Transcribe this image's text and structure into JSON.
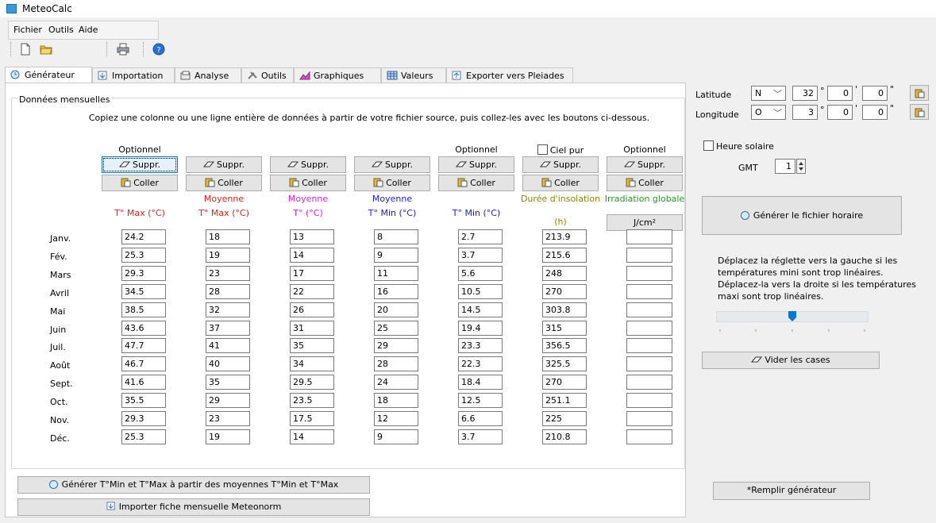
{
  "window": {
    "title": "MeteoCalc"
  },
  "menu": [
    "Fichier",
    "Outils",
    "Aide"
  ],
  "tabs": [
    "Générateur",
    "Importation",
    "Analyse",
    "Outils",
    "Graphiques",
    "Valeurs",
    "Exporter vers Pleiades"
  ],
  "group": {
    "label": "Données mensuelles"
  },
  "instructions": "Copiez une colonne ou une ligne entière de données à partir de votre fichier source, puis collez-les avec les boutons ci-dessous.",
  "buttons": {
    "suppr": "Suppr.",
    "coller": "Coller",
    "unit_jcm2": "J/cm²"
  },
  "columns": [
    {
      "top": "Optionnel",
      "sub": "",
      "label": "T° Max (°C)"
    },
    {
      "top": "",
      "sub": "Moyenne",
      "label": "T° Max (°C)"
    },
    {
      "top": "",
      "sub": "Moyenne",
      "label": "T° (°C)"
    },
    {
      "top": "",
      "sub": "Moyenne",
      "label": "T° Min (°C)"
    },
    {
      "top": "Optionnel",
      "sub": "",
      "label": "T° Min (°C)"
    },
    {
      "top": "Ciel pur",
      "sub": "Durée d'insolation",
      "label": "(h)"
    },
    {
      "top": "Optionnel",
      "sub": "Irradiation globale",
      "label": ""
    }
  ],
  "months": [
    "Janv.",
    "Fév.",
    "Mars",
    "Avril",
    "Mai",
    "Juin",
    "Juil.",
    "Août",
    "Sept.",
    "Oct.",
    "Nov.",
    "Déc."
  ],
  "rows": [
    [
      "24.2",
      "18",
      "13",
      "8",
      "2.7",
      "213.9",
      ""
    ],
    [
      "25.3",
      "19",
      "14",
      "9",
      "3.7",
      "215.6",
      ""
    ],
    [
      "29.3",
      "23",
      "17",
      "11",
      "5.6",
      "248",
      ""
    ],
    [
      "34.5",
      "28",
      "22",
      "16",
      "10.5",
      "270",
      ""
    ],
    [
      "38.5",
      "32",
      "26",
      "20",
      "14.5",
      "303.8",
      ""
    ],
    [
      "43.6",
      "37",
      "31",
      "25",
      "19.4",
      "315",
      ""
    ],
    [
      "47.7",
      "41",
      "35",
      "29",
      "23.3",
      "356.5",
      ""
    ],
    [
      "46.7",
      "40",
      "34",
      "28",
      "22.3",
      "325.5",
      ""
    ],
    [
      "41.6",
      "35",
      "29.5",
      "24",
      "18.4",
      "270",
      ""
    ],
    [
      "35.5",
      "29",
      "23.5",
      "18",
      "12.5",
      "251.1",
      ""
    ],
    [
      "29.3",
      "23",
      "17.5",
      "12",
      "6.6",
      "225",
      ""
    ],
    [
      "25.3",
      "19",
      "14",
      "9",
      "3.7",
      "210.8",
      ""
    ]
  ],
  "location": {
    "latitude_label": "Latitude",
    "lat_dir": "N",
    "lat_deg": "32",
    "lat_min": "0",
    "lat_sec": "0",
    "longitude_label": "Longitude",
    "lon_dir": "O",
    "lon_deg": "3",
    "lon_min": "0",
    "lon_sec": "0",
    "deg_sym": "°",
    "min_sym": "'",
    "sec_sym": "\""
  },
  "solar": {
    "heure_solaire": "Heure solaire",
    "gmt_label": "GMT",
    "gmt_value": "1"
  },
  "actions": {
    "generer_horaire": "Générer le fichier horaire",
    "slider_help": "Déplacez la réglette vers la gauche si les températures mini sont trop linéaires. Déplacez-la vers la droite si les températures maxi sont trop linéaires.",
    "slider_value": 0.5,
    "vider": "Vider les cases",
    "generer_minmax": "Générer T°Min et T°Max à partir des moyennes T°Min et T°Max",
    "importer": "Importer fiche mensuelle Meteonorm",
    "remplir": "*Remplir générateur"
  },
  "colors": {
    "red": "#e02020",
    "magenta": "#e020e0",
    "blue": "#2020d0",
    "olive": "#8a8a00",
    "green": "#2a9a2a",
    "accent": "#0078d7"
  }
}
